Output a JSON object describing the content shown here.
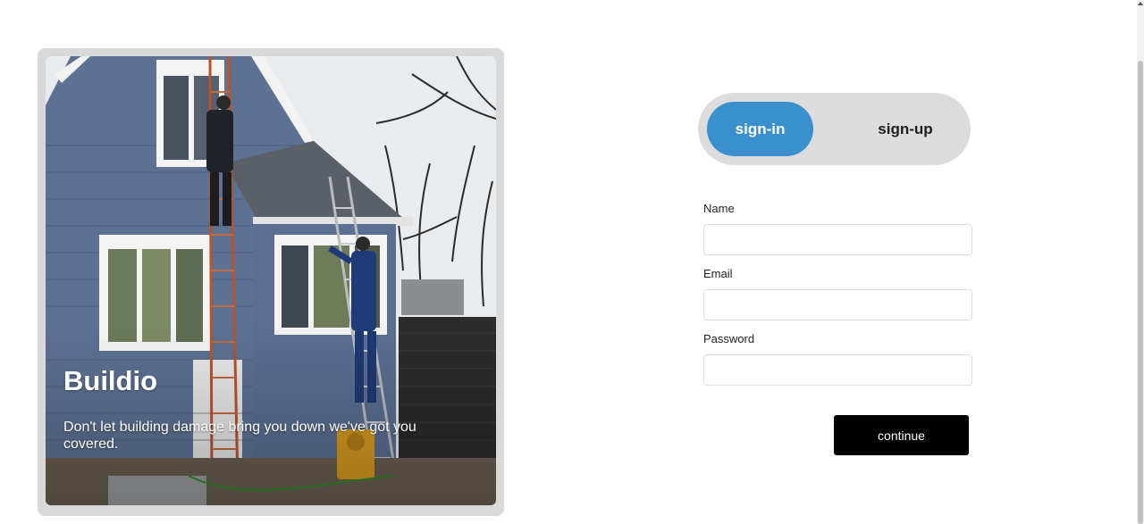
{
  "hero": {
    "brand": "Buildio",
    "tagline": "Don't let building damage bring you down we've got you covered."
  },
  "auth_toggle": {
    "signin_label": "sign-in",
    "signup_label": "sign-up",
    "active": "sign-in"
  },
  "form": {
    "name_label": "Name",
    "name_value": "",
    "email_label": "Email",
    "email_value": "",
    "password_label": "Password",
    "password_value": "",
    "continue_label": "continue"
  },
  "colors": {
    "accent": "#3a8fcd",
    "button": "#000000",
    "toggle_bg": "#dcdcdc",
    "card_bg": "#d9d9d9"
  }
}
